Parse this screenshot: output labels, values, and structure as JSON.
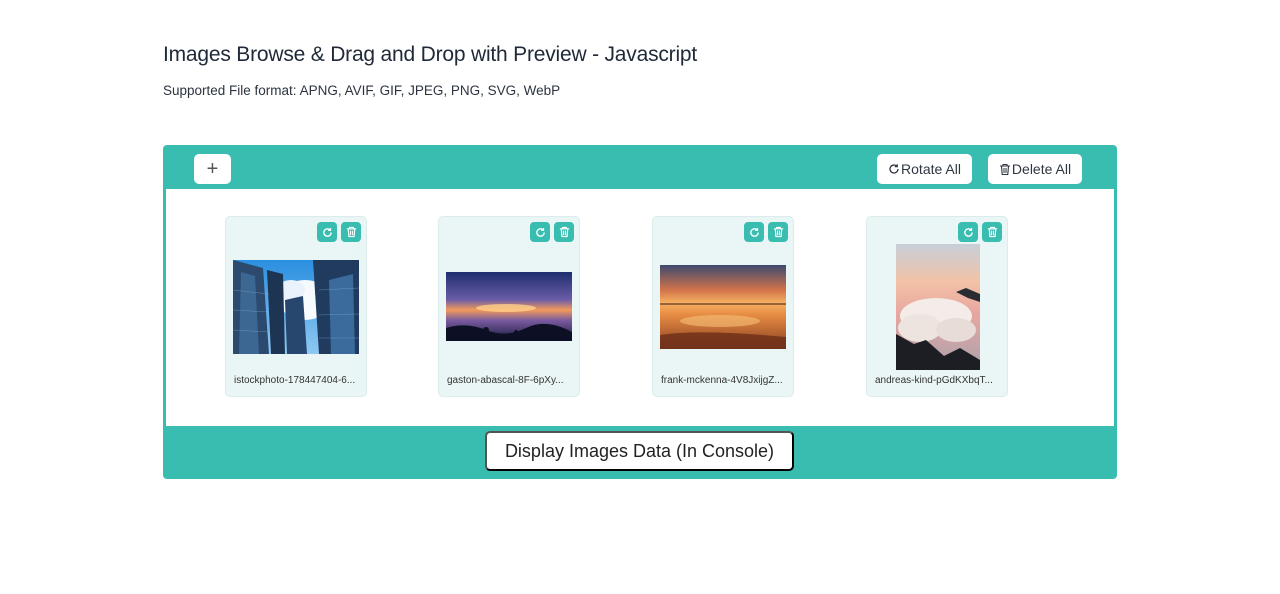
{
  "header": {
    "title": "Images Browse & Drag and Drop with Preview - Javascript",
    "subtitle": "Supported File format: APNG, AVIF, GIF, JPEG, PNG, SVG, WebP"
  },
  "toolbar": {
    "add_label": "+",
    "rotate_all_label": "Rotate All",
    "delete_all_label": "Delete All"
  },
  "images": [
    {
      "name": "istockphoto-178447404-6...",
      "subject": "skyscrapers"
    },
    {
      "name": "gaston-abascal-8F-6pXy...",
      "subject": "sunset-lake"
    },
    {
      "name": "frank-mckenna-4V8JxijgZ...",
      "subject": "beach-sunset"
    },
    {
      "name": "andreas-kind-pGdKXbqT...",
      "subject": "clouds-mountain"
    }
  ],
  "footer": {
    "display_label": "Display Images Data (In Console)"
  },
  "colors": {
    "accent": "#39bdb1",
    "card_bg": "#eaf6f5"
  },
  "icons": [
    "plus-icon",
    "rotate-icon",
    "trash-icon"
  ]
}
